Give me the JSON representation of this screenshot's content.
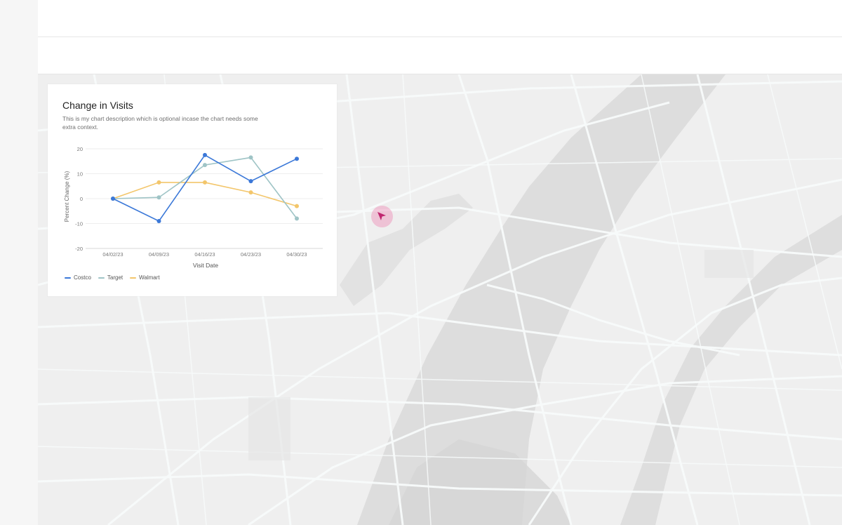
{
  "chart_card": {
    "title": "Change in Visits",
    "description": "This is my chart description which is optional incase the chart needs some extra context."
  },
  "chart_data": {
    "type": "line",
    "title": "Change in Visits",
    "subtitle": "This is my chart description which is optional incase the chart needs some extra context.",
    "xlabel": "Visit Date",
    "ylabel": "Percent Change (%)",
    "categories": [
      "04/02/23",
      "04/09/23",
      "04/16/23",
      "04/23/23",
      "04/30/23"
    ],
    "yticks": [
      20,
      10,
      0,
      -10,
      -20
    ],
    "ylim": [
      -20,
      20
    ],
    "grid": true,
    "legend": "bottom-left",
    "series": [
      {
        "name": "Costco",
        "color": "#3b78d8",
        "values": [
          0,
          -9,
          17.5,
          7,
          16
        ]
      },
      {
        "name": "Target",
        "color": "#9fc4c6",
        "values": [
          0,
          0.5,
          13.5,
          16.5,
          -8
        ]
      },
      {
        "name": "Walmart",
        "color": "#f3c66b",
        "values": [
          0,
          6.5,
          6.5,
          2.5,
          -3
        ]
      }
    ]
  },
  "colors": {
    "map_background": "#efefef",
    "map_roads": "#f8fbfb",
    "map_water": "#dcdcdc",
    "cursor": "#c0266f"
  },
  "icons": {
    "cursor": "pointer-arrow-icon"
  }
}
